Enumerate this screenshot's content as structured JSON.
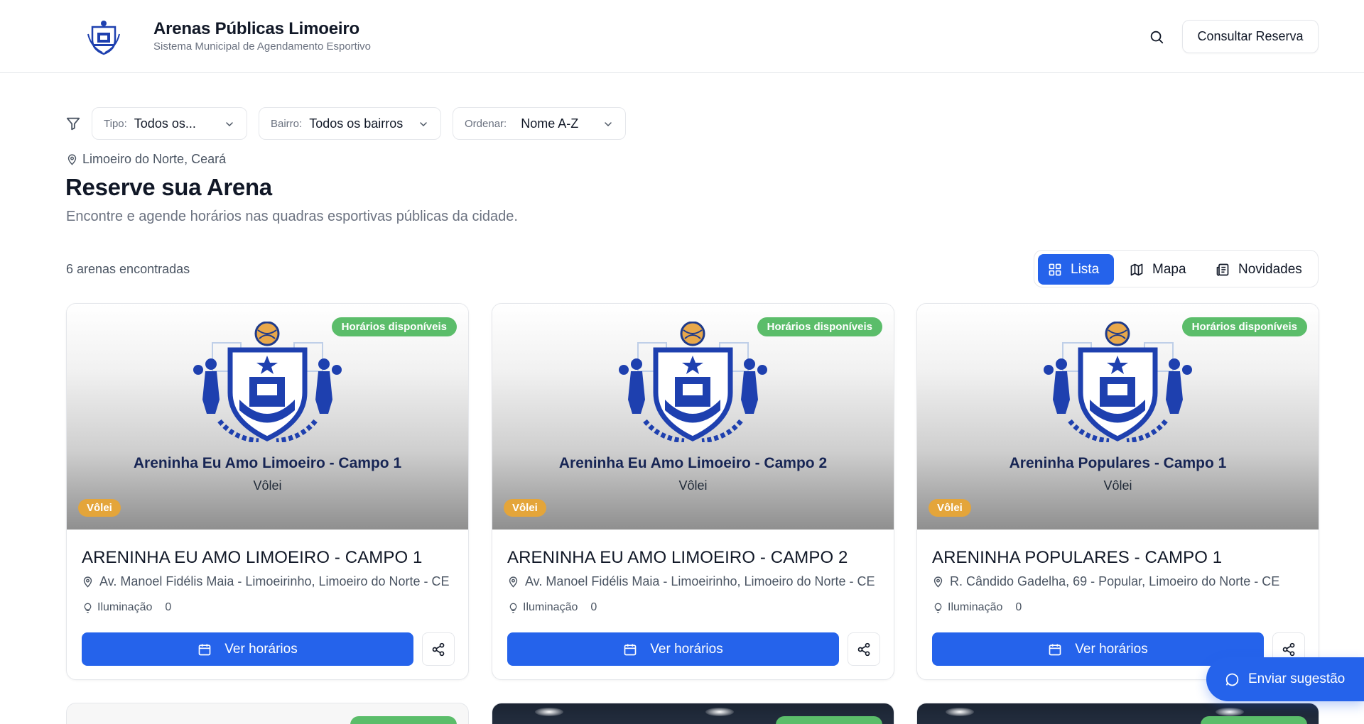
{
  "header": {
    "title": "Arenas Públicas Limoeiro",
    "subtitle": "Sistema Municipal de Agendamento Esportivo",
    "search_icon": "search-icon",
    "consult_label": "Consultar Reserva"
  },
  "filters": {
    "tipo": {
      "label": "Tipo:",
      "value": "Todos os..."
    },
    "bairro": {
      "label": "Bairro:",
      "value": "Todos os bairros"
    },
    "ordenar": {
      "label": "Ordenar:",
      "value": "Nome A-Z"
    }
  },
  "location": "Limoeiro do Norte, Ceará",
  "page_title": "Reserve sua Arena",
  "page_description": "Encontre e agende horários nas quadras esportivas públicas da cidade.",
  "results_count": "6 arenas encontradas",
  "view_toggle": {
    "list": "Lista",
    "map": "Mapa",
    "news": "Novidades",
    "active": "Lista"
  },
  "cards": [
    {
      "image_name": "Areninha Eu Amo Limoeiro - Campo 1",
      "image_sport": "Vôlei",
      "availability": "Horários disponíveis",
      "sport": "Vôlei",
      "title": "ARENINHA EU AMO LIMOEIRO - CAMPO 1",
      "address": "Av. Manoel Fidélis Maia - Limoeirinho, Limoeiro do Norte - CE",
      "lighting_label": "Iluminação",
      "lighting_value": "0",
      "hours_label": "Ver horários"
    },
    {
      "image_name": "Areninha Eu Amo Limoeiro - Campo 2",
      "image_sport": "Vôlei",
      "availability": "Horários disponíveis",
      "sport": "Vôlei",
      "title": "ARENINHA EU AMO LIMOEIRO - CAMPO 2",
      "address": "Av. Manoel Fidélis Maia - Limoeirinho, Limoeiro do Norte - CE",
      "lighting_label": "Iluminação",
      "lighting_value": "0",
      "hours_label": "Ver horários"
    },
    {
      "image_name": "Areninha Populares - Campo 1",
      "image_sport": "Vôlei",
      "availability": "Horários disponíveis",
      "sport": "Vôlei",
      "title": "ARENINHA POPULARES - CAMPO 1",
      "address": "R. Cândido Gadelha, 69 - Popular, Limoeiro do Norte - CE",
      "lighting_label": "Iluminação",
      "lighting_value": "0",
      "hours_label": "Ver horários"
    }
  ],
  "suggest_label": "Enviar sugestão",
  "colors": {
    "primary": "#2563eb",
    "available": "#5bbd6a",
    "sport_badge": "#e4a53a",
    "crest_blue": "#1e40af"
  }
}
